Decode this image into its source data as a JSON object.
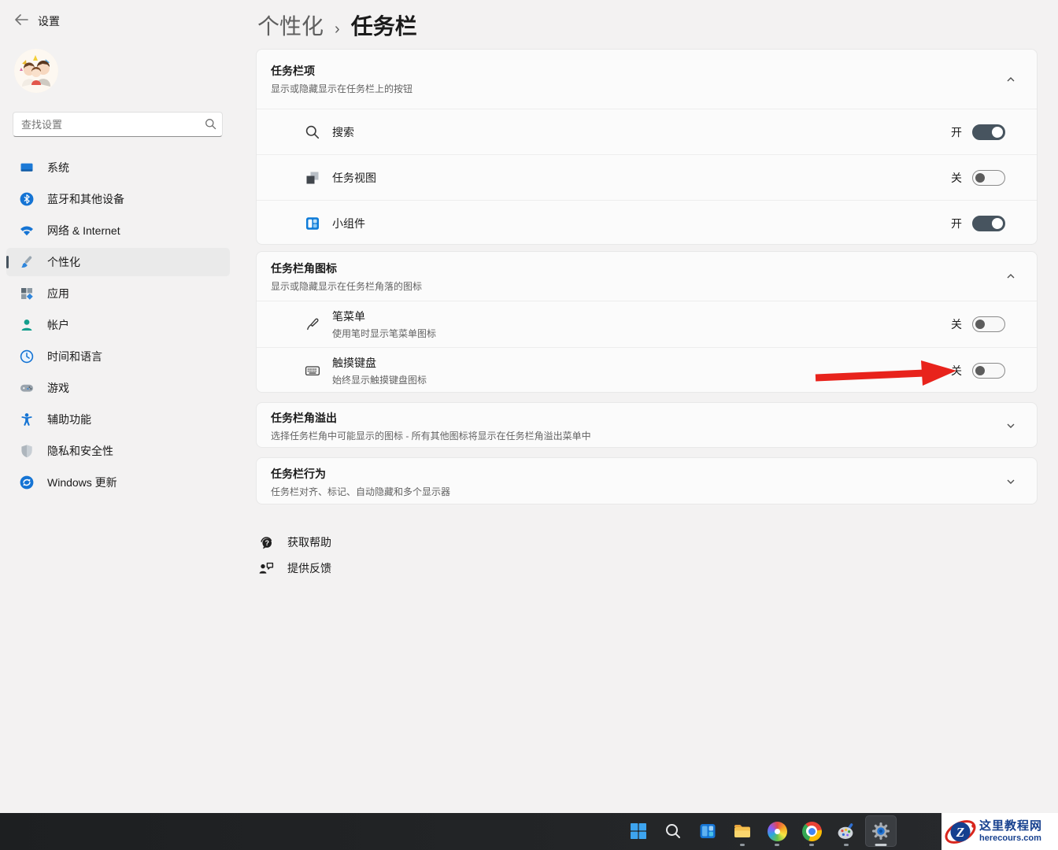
{
  "window": {
    "title": "设置",
    "back_icon": "back-arrow-icon"
  },
  "sidebar": {
    "search": {
      "placeholder": "查找设置",
      "icon": "search-icon"
    },
    "items": [
      {
        "label": "系统",
        "icon": "system-icon",
        "selected": false
      },
      {
        "label": "蓝牙和其他设备",
        "icon": "bluetooth-icon",
        "selected": false
      },
      {
        "label": "网络 & Internet",
        "icon": "network-icon",
        "selected": false
      },
      {
        "label": "个性化",
        "icon": "personalization-icon",
        "selected": true
      },
      {
        "label": "应用",
        "icon": "apps-icon",
        "selected": false
      },
      {
        "label": "帐户",
        "icon": "accounts-icon",
        "selected": false
      },
      {
        "label": "时间和语言",
        "icon": "time-language-icon",
        "selected": false
      },
      {
        "label": "游戏",
        "icon": "gaming-icon",
        "selected": false
      },
      {
        "label": "辅助功能",
        "icon": "accessibility-icon",
        "selected": false
      },
      {
        "label": "隐私和安全性",
        "icon": "privacy-icon",
        "selected": false
      },
      {
        "label": "Windows 更新",
        "icon": "windows-update-icon",
        "selected": false
      }
    ]
  },
  "header": {
    "breadcrumb_parent": "个性化",
    "breadcrumb_separator": "›",
    "page_title": "任务栏"
  },
  "sections": {
    "taskbar_items": {
      "title": "任务栏项",
      "subtitle": "显示或隐藏显示在任务栏上的按钮",
      "expanded": true,
      "rows": [
        {
          "label": "搜索",
          "icon": "search-icon",
          "state": "开",
          "on": true
        },
        {
          "label": "任务视图",
          "icon": "task-view-icon",
          "state": "关",
          "on": false
        },
        {
          "label": "小组件",
          "icon": "widgets-icon",
          "state": "开",
          "on": true
        }
      ]
    },
    "corner_icons": {
      "title": "任务栏角图标",
      "subtitle": "显示或隐藏显示在任务栏角落的图标",
      "expanded": true,
      "rows": [
        {
          "label": "笔菜单",
          "description": "使用笔时显示笔菜单图标",
          "icon": "pen-icon",
          "state": "关",
          "on": false
        },
        {
          "label": "触摸键盘",
          "description": "始终显示触摸键盘图标",
          "icon": "touch-keyboard-icon",
          "state": "关",
          "on": false
        }
      ]
    },
    "corner_overflow": {
      "title": "任务栏角溢出",
      "subtitle": "选择任务栏角中可能显示的图标 - 所有其他图标将显示在任务栏角溢出菜单中",
      "expanded": false
    },
    "behaviors": {
      "title": "任务栏行为",
      "subtitle": "任务栏对齐、标记、自动隐藏和多个显示器",
      "expanded": false
    }
  },
  "links": {
    "get_help": "获取帮助",
    "send_feedback": "提供反馈"
  },
  "annotation": {
    "shape": "red-arrow",
    "color": "#e8231c"
  },
  "taskbar": {
    "items": [
      {
        "name": "start",
        "icon": "windows-start-icon",
        "indicator": "none",
        "active": false
      },
      {
        "name": "search",
        "icon": "taskbar-search-icon",
        "indicator": "none",
        "active": false
      },
      {
        "name": "widgets",
        "icon": "taskbar-widgets-icon",
        "indicator": "none",
        "active": false
      },
      {
        "name": "file-explorer",
        "icon": "folder-icon",
        "indicator": "running",
        "active": false
      },
      {
        "name": "color-wheel-app",
        "icon": "color-wheel-icon",
        "indicator": "running",
        "active": false
      },
      {
        "name": "chrome",
        "icon": "chrome-icon",
        "indicator": "running",
        "active": false
      },
      {
        "name": "paint",
        "icon": "paint-palette-icon",
        "indicator": "running",
        "active": false
      },
      {
        "name": "settings",
        "icon": "gear-icon",
        "indicator": "running",
        "active": true
      }
    ]
  },
  "watermark": {
    "site_name": "这里教程网",
    "site_domain": "herecours.com",
    "logo_letter": "Z"
  },
  "colors": {
    "toggle_on": "#47545f",
    "arrow_red": "#e8231c",
    "taskbar_bg": "#232527",
    "accent_blue": "#1574d4"
  }
}
